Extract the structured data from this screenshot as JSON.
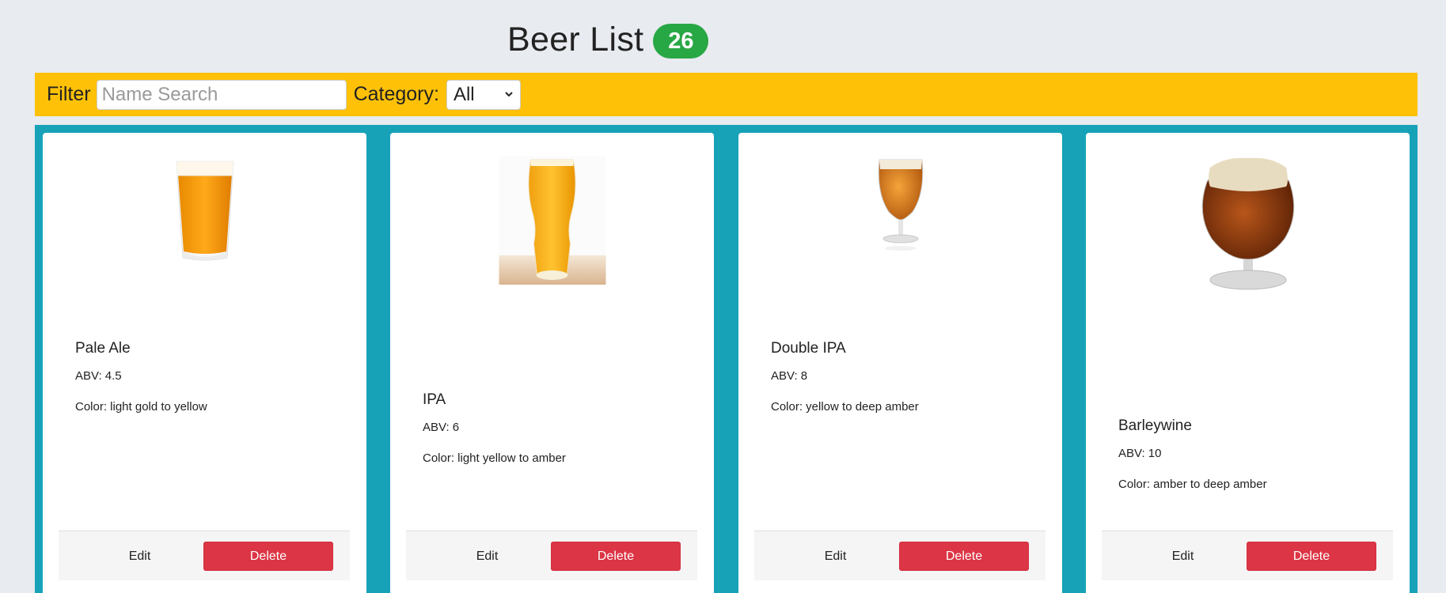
{
  "header": {
    "title": "Beer List",
    "count": "26"
  },
  "filter": {
    "label": "Filter",
    "search_placeholder": "Name Search",
    "search_value": "",
    "category_label": "Category:",
    "category_selected": "All"
  },
  "colors": {
    "background": "#e8ebef",
    "filter_bar": "#ffc107",
    "card_area": "#17a2b8",
    "badge": "#28a745",
    "delete": "#dc3545"
  },
  "cards": [
    {
      "name": "Pale Ale",
      "abv": "ABV: 4.5",
      "color": "Color: light gold to yellow",
      "glass": "pint-glass-icon",
      "edit_label": "Edit",
      "delete_label": "Delete"
    },
    {
      "name": "IPA",
      "abv": "ABV: 6",
      "color": "Color: light yellow to amber",
      "glass": "ipa-glass-icon",
      "edit_label": "Edit",
      "delete_label": "Delete"
    },
    {
      "name": "Double IPA",
      "abv": "ABV: 8",
      "color": "Color: yellow to deep amber",
      "glass": "tulip-glass-icon",
      "edit_label": "Edit",
      "delete_label": "Delete"
    },
    {
      "name": "Barleywine",
      "abv": "ABV: 10",
      "color": "Color: amber to deep amber",
      "glass": "snifter-glass-icon",
      "edit_label": "Edit",
      "delete_label": "Delete"
    }
  ]
}
